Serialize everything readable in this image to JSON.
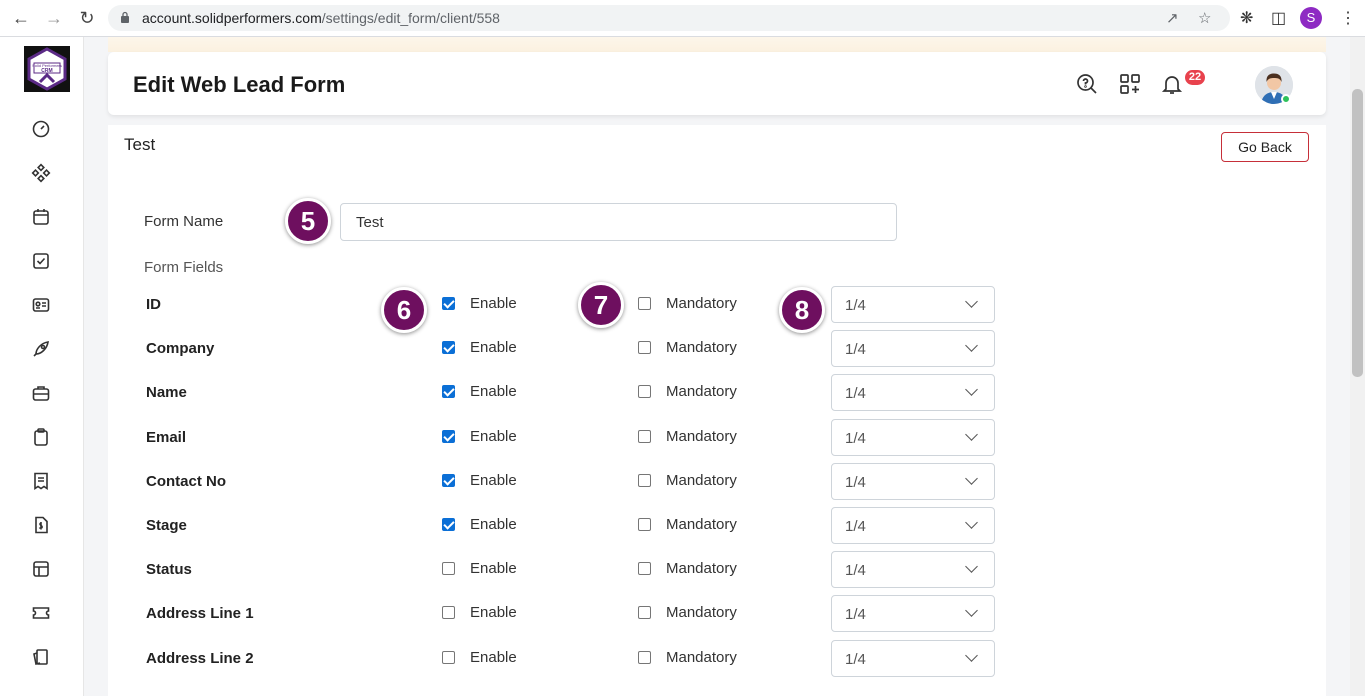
{
  "browser": {
    "url_host": "account.solidperformers.com",
    "url_path": "/settings/edit_form/client/558",
    "profile_initial": "S"
  },
  "header": {
    "title": "Edit Web Lead Form",
    "notification_count": "22"
  },
  "logo": {
    "line1": "Solid Performers",
    "line2": "CRM"
  },
  "card": {
    "title": "Test",
    "go_back_label": "Go Back",
    "form_name_label": "Form Name",
    "form_name_value": "Test",
    "form_fields_label": "Form Fields"
  },
  "markers": [
    "5",
    "6",
    "7",
    "8"
  ],
  "checkbox_labels": {
    "enable": "Enable",
    "mandatory": "Mandatory"
  },
  "fields": [
    {
      "name": "ID",
      "enabled": true,
      "mandatory": false,
      "width": "1/4"
    },
    {
      "name": "Company",
      "enabled": true,
      "mandatory": false,
      "width": "1/4"
    },
    {
      "name": "Name",
      "enabled": true,
      "mandatory": false,
      "width": "1/4"
    },
    {
      "name": "Email",
      "enabled": true,
      "mandatory": false,
      "width": "1/4"
    },
    {
      "name": "Contact No",
      "enabled": true,
      "mandatory": false,
      "width": "1/4"
    },
    {
      "name": "Stage",
      "enabled": true,
      "mandatory": false,
      "width": "1/4"
    },
    {
      "name": "Status",
      "enabled": false,
      "mandatory": false,
      "width": "1/4"
    },
    {
      "name": "Address Line 1",
      "enabled": false,
      "mandatory": false,
      "width": "1/4"
    },
    {
      "name": "Address Line 2",
      "enabled": false,
      "mandatory": false,
      "width": "1/4"
    }
  ],
  "sidebar_icons": [
    "dashboard-icon",
    "modules-icon",
    "calendar-icon",
    "tasks-icon",
    "contacts-card-icon",
    "rocket-icon",
    "briefcase-icon",
    "clipboard-icon",
    "report-icon",
    "invoice-icon",
    "table-icon",
    "ticket-icon",
    "documents-icon"
  ],
  "colors": {
    "accent": "#6e0f5f",
    "checkbox": "#0b6fd6",
    "danger": "#c62f39",
    "badge": "#e8424d"
  }
}
